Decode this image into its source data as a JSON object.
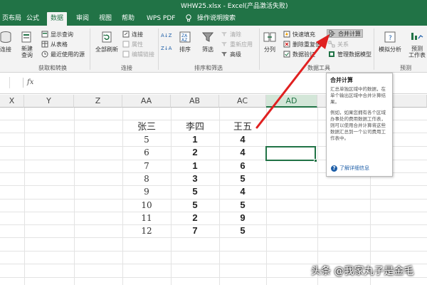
{
  "window": {
    "title": "WHW25.xlsx  -  Excel(产品激活失败)"
  },
  "tabs": [
    {
      "label": "页布局",
      "active": false
    },
    {
      "label": "公式",
      "active": false
    },
    {
      "label": "数据",
      "active": true
    },
    {
      "label": "审阅",
      "active": false
    },
    {
      "label": "视图",
      "active": false
    },
    {
      "label": "帮助",
      "active": false
    },
    {
      "label": "WPS PDF",
      "active": false
    },
    {
      "label": "操作说明搜索",
      "active": false
    }
  ],
  "ribbon": {
    "get_data": {
      "connect": "连接",
      "new_query": "新建\n查询",
      "show_query": "显示查询",
      "from_table": "从表格",
      "recent_sources": "最近使用的源",
      "label": "获取和转换"
    },
    "connections": {
      "refresh_all": "全部刷新",
      "connections": "连接",
      "properties": "属性",
      "edit_links": "编辑链接",
      "label": "连接"
    },
    "sort_filter": {
      "sort_az": "A↓Z",
      "sort_za": "Z↓A",
      "sort": "排序",
      "filter": "筛选",
      "clear": "清除",
      "reapply": "重新应用",
      "advanced": "高级",
      "label": "排序和筛选"
    },
    "data_tools": {
      "text_to_columns": "分列",
      "flash_fill": "快速填充",
      "remove_duplicates": "删除重复值",
      "data_validation": "数据验证",
      "consolidate": "合并计算",
      "relationships": "关系",
      "manage_model": "管理数据模型",
      "label": "数据工具"
    },
    "forecast": {
      "what_if": "模拟分析",
      "forecast_sheet": "预测\n工作表",
      "label": "预测"
    }
  },
  "formula_bar": {
    "fx": "fx"
  },
  "grid": {
    "columns": [
      "X",
      "Y",
      "Z",
      "AA",
      "AB",
      "AC",
      "AD"
    ],
    "selected_column": "AD",
    "headers": {
      "aa": "张三",
      "ab": "李四",
      "ac": "王五"
    },
    "rows": [
      {
        "aa": "5",
        "ab": "1",
        "ac": "4"
      },
      {
        "aa": "6",
        "ab": "2",
        "ac": "4"
      },
      {
        "aa": "7",
        "ab": "1",
        "ac": "6"
      },
      {
        "aa": "8",
        "ab": "3",
        "ac": "5"
      },
      {
        "aa": "9",
        "ab": "5",
        "ac": "4"
      },
      {
        "aa": "10",
        "ab": "5",
        "ac": "5"
      },
      {
        "aa": "11",
        "ab": "2",
        "ac": "9"
      },
      {
        "aa": "12",
        "ab": "7",
        "ac": "5"
      }
    ]
  },
  "tooltip": {
    "title": "合并计算",
    "body": "汇总单独区域中的数据，在单个输出区域中合并计算结果。",
    "body2": "例如，如果您拥有各个区域办事处的费用数据工作表，则可以使用合并计算将这些数据汇总到一个公司费用工作表中。",
    "link": "了解详细信息"
  },
  "watermark": {
    "text": "头条 @我家丸子是金毛"
  },
  "colors": {
    "accent": "#217346",
    "arrow": "#e02020",
    "link": "#1f5fa8"
  }
}
